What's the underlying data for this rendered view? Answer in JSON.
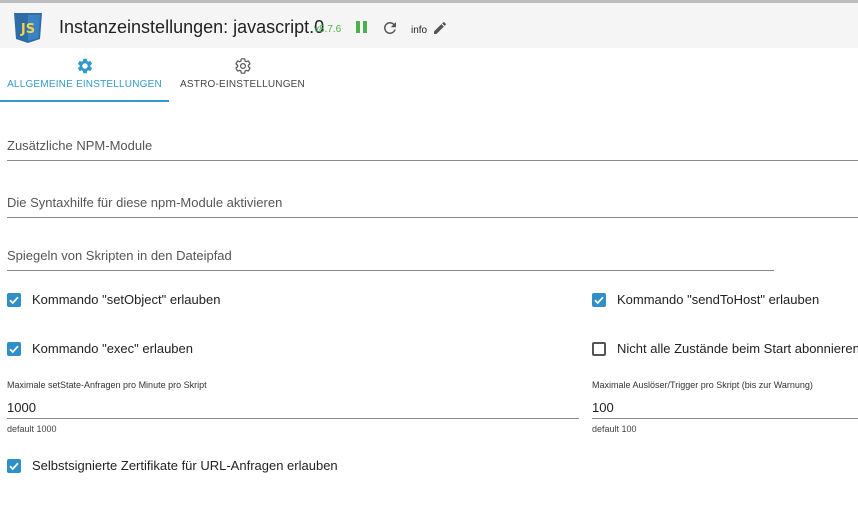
{
  "header": {
    "title": "Instanzeinstellungen: javascript.0",
    "version": "v8.7.6",
    "loglevel": "info",
    "logo_text": "JS",
    "colors": {
      "logo_bg": "#2e6ca8",
      "logo_accent": "#f1d24b",
      "status": "#4caf50"
    }
  },
  "tabs": [
    {
      "label": "ALLGEMEINE EINSTELLUNGEN",
      "icon": "gear-filled-icon",
      "active": true
    },
    {
      "label": "ASTRO-EINSTELLUNGEN",
      "icon": "gear-outline-icon",
      "active": false
    }
  ],
  "fields": {
    "npm_modules": {
      "placeholder": "Zusätzliche NPM-Module",
      "value": ""
    },
    "syntax_help": {
      "placeholder": "Die Syntaxhilfe für diese npm-Module aktivieren",
      "value": ""
    },
    "mirror_path": {
      "placeholder": "Spiegeln von Skripten in den Dateipfad",
      "value": ""
    }
  },
  "checkboxes": {
    "set_object": {
      "label": "Kommando \"setObject\" erlauben",
      "checked": true
    },
    "send_to_host": {
      "label": "Kommando \"sendToHost\" erlauben",
      "checked": true
    },
    "exec": {
      "label": "Kommando \"exec\" erlauben",
      "checked": true
    },
    "no_subscribe": {
      "label": "Nicht alle Zustände beim Start abonnieren",
      "checked": false
    },
    "self_signed": {
      "label": "Selbstsignierte Zertifikate für URL-Anfragen erlauben",
      "checked": true
    }
  },
  "numbers": {
    "max_setstate": {
      "label": "Maximale setState-Anfragen pro Minute pro Skript",
      "value": "1000",
      "help": "default 1000"
    },
    "max_triggers": {
      "label": "Maximale Auslöser/Trigger pro Skript (bis zur Warnung)",
      "value": "100",
      "help": "default 100"
    }
  },
  "accent_color": "#3399cc"
}
